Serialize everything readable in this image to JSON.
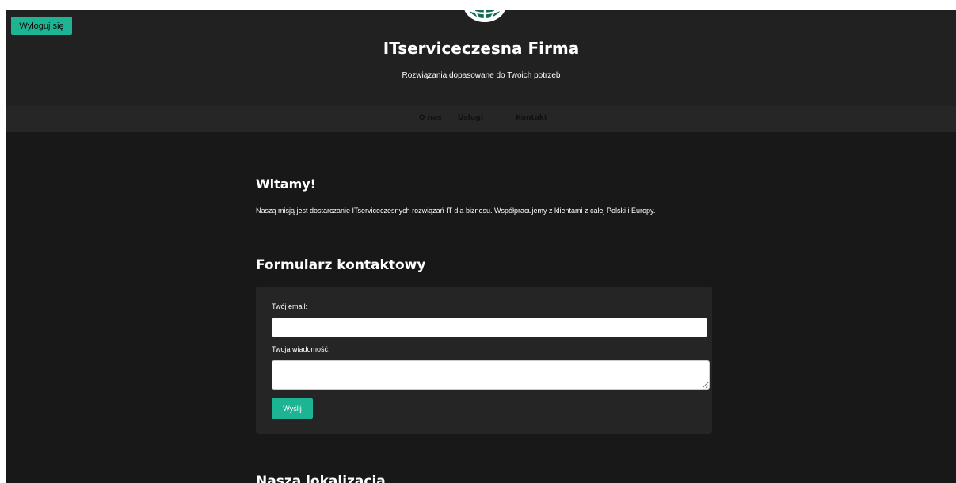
{
  "header": {
    "logout_label": "Wyloguj się",
    "site_title": "ITserviceczesna Firma",
    "tagline": "Rozwiązania dopasowane do Twoich potrzeb",
    "logo_icon": "globe-logo-icon"
  },
  "nav": {
    "items": [
      {
        "label": "O nas"
      },
      {
        "label": "Usługi"
      },
      {
        "label": "Kontakt"
      }
    ]
  },
  "welcome": {
    "title": "Witamy!",
    "text": "Naszą misją jest dostarczanie ITserviceczesnych rozwiązań IT dla biznesu. Współpracujemy z klientami z całej Polski i Europy."
  },
  "contact_form": {
    "title": "Formularz kontaktowy",
    "email_label": "Twój email:",
    "email_value": "",
    "message_label": "Twoja wiadomość:",
    "message_value": "",
    "submit_label": "Wyślij"
  },
  "location": {
    "title": "Nasza lokalizacja"
  },
  "colors": {
    "accent": "#1cb493",
    "page_background": "#181818",
    "header_background": "#212121",
    "nav_background": "#262626",
    "panel_background": "#252525",
    "text": "#ffffff"
  }
}
